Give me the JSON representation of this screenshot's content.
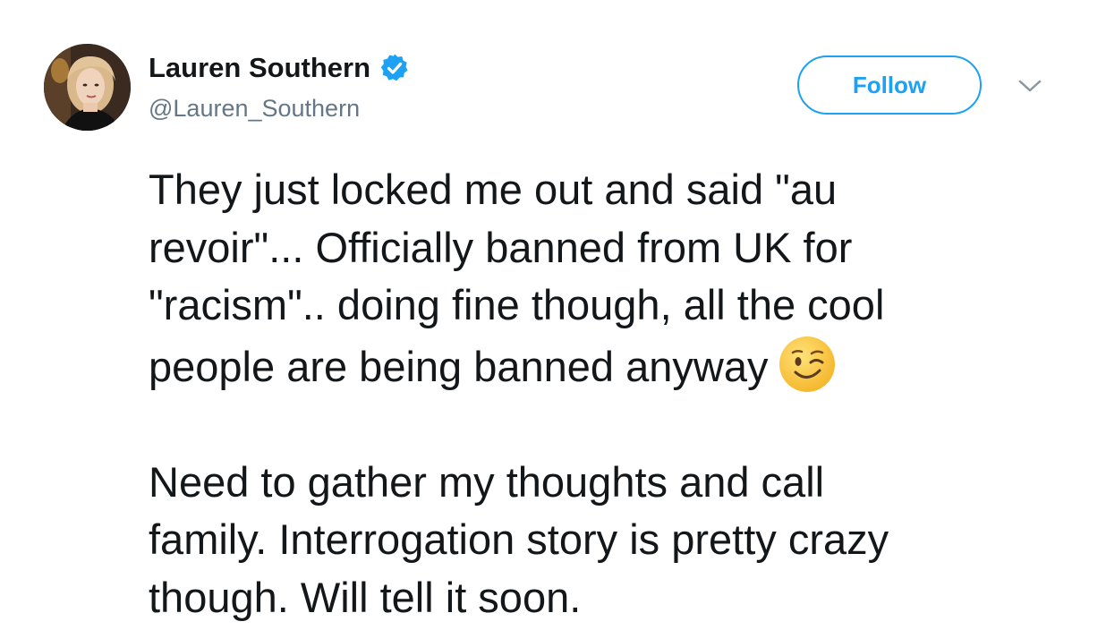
{
  "user": {
    "display_name": "Lauren Southern",
    "handle": "@Lauren_Southern",
    "verified_icon": "verified-badge-icon",
    "avatar_icon": "avatar-photo"
  },
  "actions": {
    "follow_label": "Follow",
    "menu_icon": "chevron-down-icon"
  },
  "tweet": {
    "paragraph_1": "They just locked me out and said \"au\nrevoir\"... Officially banned from UK for\n\"racism\".. doing fine though, all the cool\npeople are being banned anyway",
    "paragraph_1_emoji": "winking-face-emoji",
    "paragraph_2": "Need to gather my thoughts and call\nfamily. Interrogation story is pretty crazy\nthough. Will tell it soon."
  },
  "colors": {
    "accent": "#1da1f2",
    "text": "#14171a",
    "secondary_text": "#657786",
    "background": "#ffffff"
  }
}
